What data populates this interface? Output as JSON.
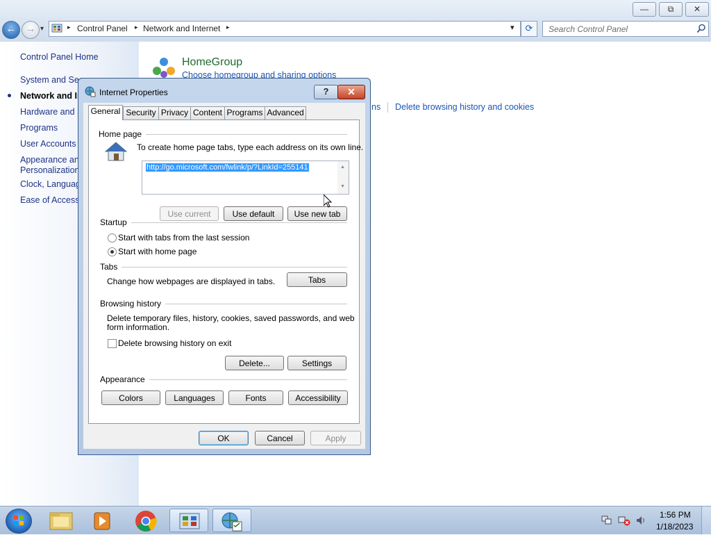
{
  "window": {
    "caption_buttons": {
      "minimize": "—",
      "maximize": "⧉",
      "close": "✕"
    }
  },
  "address_bar": {
    "back": "←",
    "forward": "→",
    "crumbs": [
      "Control Panel",
      "Network and Internet"
    ],
    "separator": "▸",
    "dropdown": "▾",
    "refresh": "⟳",
    "search_placeholder": "Search Control Panel"
  },
  "left_nav": {
    "items": [
      "Control Panel Home",
      "System and Secu",
      "Network and In",
      "Hardware and S",
      "Programs",
      "User Accounts",
      "Appearance and",
      "Personalization",
      "Clock, Languag",
      "Ease of Access"
    ]
  },
  "content": {
    "homegroup_title": "HomeGroup",
    "homegroup_link": "Choose homegroup and sharing options",
    "partial_link": "ns",
    "delete_link": "Delete browsing history and cookies"
  },
  "dialog": {
    "title": "Internet Properties",
    "help": "?",
    "close": "✕",
    "tabs": [
      "General",
      "Security",
      "Privacy",
      "Content",
      "Programs",
      "Advanced"
    ],
    "active_tab": "General",
    "home_page": {
      "label": "Home page",
      "description": "To create home page tabs, type each address on its own line.",
      "url": "http://go.microsoft.com/fwlink/p/?LinkId=255141",
      "btn_current": "Use current",
      "btn_default": "Use default",
      "btn_new_tab": "Use new tab"
    },
    "startup": {
      "label": "Startup",
      "option1": "Start with tabs from the last session",
      "option2": "Start with home page",
      "selected": "Start with home page"
    },
    "tabs_group": {
      "label": "Tabs",
      "description": "Change how webpages are displayed in tabs.",
      "btn": "Tabs"
    },
    "browsing_history": {
      "label": "Browsing history",
      "description_line1": "Delete temporary files, history, cookies, saved passwords, and web",
      "description_line2": "form information.",
      "checkbox": "Delete browsing history on exit",
      "checked": false,
      "btn_delete": "Delete...",
      "btn_settings": "Settings"
    },
    "appearance": {
      "label": "Appearance",
      "btn_colors": "Colors",
      "btn_languages": "Languages",
      "btn_fonts": "Fonts",
      "btn_accessibility": "Accessibility"
    },
    "footer": {
      "ok": "OK",
      "cancel": "Cancel",
      "apply": "Apply"
    }
  },
  "taskbar": {
    "time": "1:56 PM",
    "date": "1/18/2023"
  }
}
